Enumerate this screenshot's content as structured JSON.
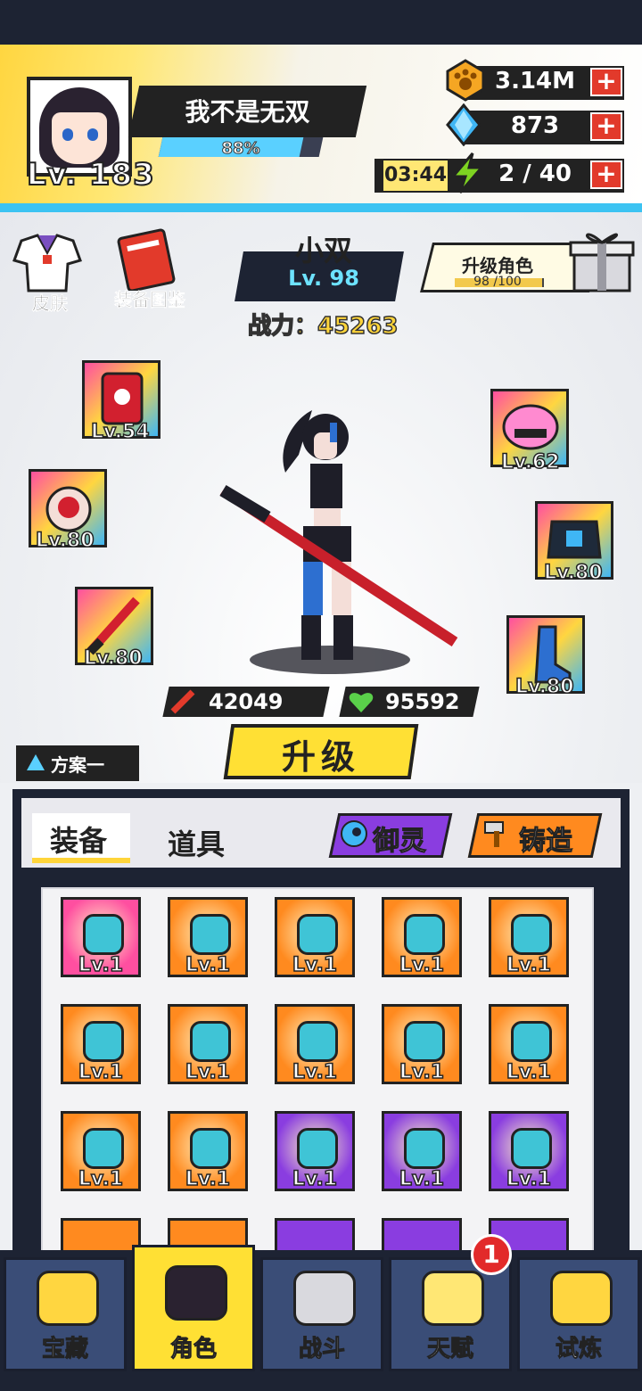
{
  "player": {
    "name": "我不是无双",
    "level_label": "Lv. 183",
    "exp_percent_text": "88%",
    "exp_fraction": 0.88
  },
  "resources": [
    {
      "icon": "paw-coin-icon",
      "value": "3.14M",
      "color": "#f5a623"
    },
    {
      "icon": "diamond-icon",
      "value": "873",
      "color": "#3fb6f5"
    },
    {
      "icon": "energy-bolt-icon",
      "value": "2 / 40",
      "color": "#7ed321",
      "timer": "03:44"
    }
  ],
  "side": {
    "skin_label": "皮肤",
    "codex_label": "装备图鉴"
  },
  "hero": {
    "name": "小双",
    "level": "Lv. 98",
    "power": "战力：45263",
    "upgrade_role_label": "升级角色",
    "upgrade_role_progress": "98 /100",
    "upgrade_role_fraction": 0.98,
    "attack": "42049",
    "hp": "95592"
  },
  "equipped": [
    {
      "icon": "red-book-icon",
      "lv": "Lv.54"
    },
    {
      "icon": "pink-helmet-icon",
      "lv": "Lv.62"
    },
    {
      "icon": "red-ring-icon",
      "lv": "Lv.80"
    },
    {
      "icon": "dark-armor-icon",
      "lv": "Lv.80"
    },
    {
      "icon": "red-sword-icon",
      "lv": "Lv.80"
    },
    {
      "icon": "blue-boot-icon",
      "lv": "Lv.80"
    }
  ],
  "buttons": {
    "upgrade": "升级",
    "plan": "方案一"
  },
  "bag": {
    "tab_equipment": "装备",
    "tab_items": "道具",
    "spirit_button": "御灵",
    "forge_button": "铸造",
    "items": [
      {
        "icon": "blade-icon",
        "lv": "Lv.1",
        "bg": "#ff4fa0"
      },
      {
        "icon": "purple-ring-icon",
        "lv": "Lv.1",
        "bg": "#ff8a1f"
      },
      {
        "icon": "paw-ring-icon",
        "lv": "Lv.1",
        "bg": "#ff8a1f"
      },
      {
        "icon": "bolt-gem-icon",
        "lv": "Lv.1",
        "bg": "#ff8a1f"
      },
      {
        "icon": "teal-pendant-icon",
        "lv": "Lv.1",
        "bg": "#ff8a1f"
      },
      {
        "icon": "teal-pendant-icon",
        "lv": "Lv.1",
        "bg": "#ff8a1f"
      },
      {
        "icon": "blue-gem-pendant-icon",
        "lv": "Lv.1",
        "bg": "#ff8a1f"
      },
      {
        "icon": "blue-gem-pendant-icon",
        "lv": "Lv.1",
        "bg": "#ff8a1f"
      },
      {
        "icon": "red-scarf-icon",
        "lv": "Lv.1",
        "bg": "#ff8a1f"
      },
      {
        "icon": "maid-dress-icon",
        "lv": "Lv.1",
        "bg": "#ff8a1f"
      },
      {
        "icon": "blue-glove-icon",
        "lv": "Lv.1",
        "bg": "#ff8a1f"
      },
      {
        "icon": "blue-slipper-icon",
        "lv": "Lv.1",
        "bg": "#ff8a1f"
      },
      {
        "icon": "light-saber-icon",
        "lv": "Lv.1",
        "bg": "#8a3de0"
      },
      {
        "icon": "orange-orb-icon",
        "lv": "Lv.1",
        "bg": "#8a3de0"
      },
      {
        "icon": "gold-necklace-icon",
        "lv": "Lv.1",
        "bg": "#8a3de0"
      }
    ]
  },
  "nav": [
    {
      "icon": "treasure-chest-icon",
      "label": "宝藏"
    },
    {
      "icon": "character-icon",
      "label": "角色"
    },
    {
      "icon": "battle-swords-icon",
      "label": "战斗"
    },
    {
      "icon": "lightbulb-icon",
      "label": "天赋"
    },
    {
      "icon": "trial-emblem-icon",
      "label": "试炼"
    }
  ],
  "nav_badge": "1"
}
